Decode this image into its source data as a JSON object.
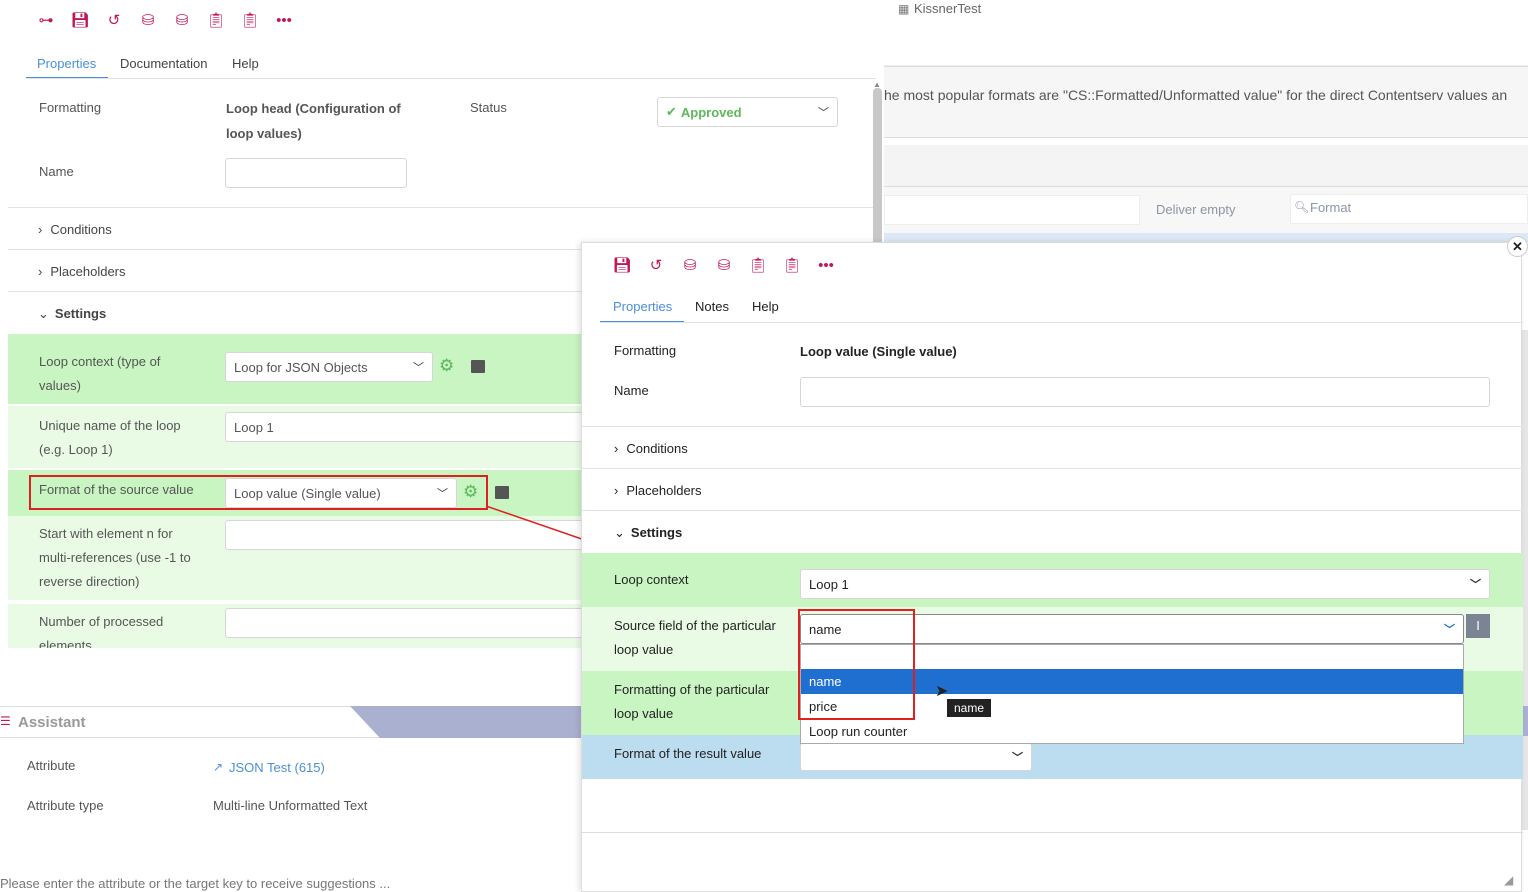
{
  "background_window": {
    "tab_title": "KissnerTest",
    "info_text": "he most popular formats are \"CS::Formatted/Unformatted value\" for the direct Contentserv values an",
    "deliver_empty": "Deliver empty",
    "format_placeholder": "Format"
  },
  "left_panel": {
    "tabs": [
      "Properties",
      "Documentation",
      "Help"
    ],
    "formatting_label": "Formatting",
    "formatting_value": "Loop head (Configuration of loop values)",
    "status_label": "Status",
    "status_value": "Approved",
    "name_label": "Name",
    "sections": {
      "conditions": "Conditions",
      "placeholders": "Placeholders",
      "settings": "Settings"
    },
    "loop_context_label": "Loop context (type of values)",
    "loop_context_value": "Loop for JSON Objects",
    "unique_name_label": "Unique name of the loop (e.g. Loop 1)",
    "unique_name_value": "Loop 1",
    "source_format_label": "Format of the source value",
    "source_format_value": "Loop value (Single value)",
    "start_label": "Start with element n for multi-references (use -1 to reverse direction)",
    "processed_label": "Number of processed elements"
  },
  "assistant": {
    "title": "Assistant",
    "attribute_label": "Attribute",
    "attribute_value": "JSON Test (615)",
    "attribute_type_label": "Attribute type",
    "attribute_type_value": "Multi-line Unformatted Text",
    "hint": "Please enter the attribute or the target key to receive suggestions ..."
  },
  "right_panel": {
    "tabs": [
      "Properties",
      "Notes",
      "Help"
    ],
    "formatting_label": "Formatting",
    "formatting_value": "Loop value (Single value)",
    "name_label": "Name",
    "sections": {
      "conditions": "Conditions",
      "placeholders": "Placeholders",
      "settings": "Settings"
    },
    "loop_context_label": "Loop context",
    "loop_context_value": "Loop 1",
    "source_field_label": "Source field of the particular loop value",
    "source_field_value": "name",
    "formatting_particular_label": "Formatting of the particular loop value",
    "result_format_label": "Format of the result value",
    "dropdown_options": [
      "name",
      "price",
      "Loop run counter"
    ],
    "tooltip": "name"
  },
  "colors": {
    "accent": "#4a90d9",
    "icon": "#c2185b",
    "approved": "#5cb85c",
    "highlight": "#e02020",
    "selected": "#1e6fd0"
  }
}
